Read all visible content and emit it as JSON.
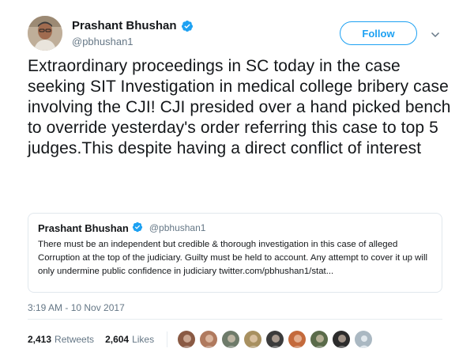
{
  "author": {
    "name": "Prashant Bhushan",
    "handle": "@pbhushan1",
    "verified": true
  },
  "follow_label": "Follow",
  "tweet_text": "Extraordinary proceedings in SC today in the case seeking SIT Investigation in medical college bribery case involving the CJI! CJI presided over a hand picked bench to override yesterday's order referring this case to top 5 judges.This despite having a direct conflict of interest",
  "quoted": {
    "name": "Prashant Bhushan",
    "handle": "@pbhushan1",
    "text": "There must be an independent but credible & thorough investigation in this case of alleged Corruption at the top of the judiciary. Guilty must be held to account. Any attempt to cover it up will only undermine public confidence in judiciary twitter.com/pbhushan1/stat..."
  },
  "timestamp": "3:19 AM - 10 Nov 2017",
  "stats": {
    "retweets_count": "2,413",
    "retweets_label": "Retweets",
    "likes_count": "2,604",
    "likes_label": "Likes"
  },
  "likers": [
    {
      "color": "#8a5a44"
    },
    {
      "color": "#b07a5e"
    },
    {
      "color": "#6e7b6a"
    },
    {
      "color": "#a89060"
    },
    {
      "color": "#3b3b3b"
    },
    {
      "color": "#c46a3c"
    },
    {
      "color": "#5a6b4a"
    },
    {
      "color": "#2c2c2c"
    },
    {
      "color": "#aab8c2"
    }
  ],
  "colors": {
    "accent": "#1da1f2",
    "text": "#14171a",
    "secondary": "#657786",
    "border": "#e1e8ed"
  }
}
